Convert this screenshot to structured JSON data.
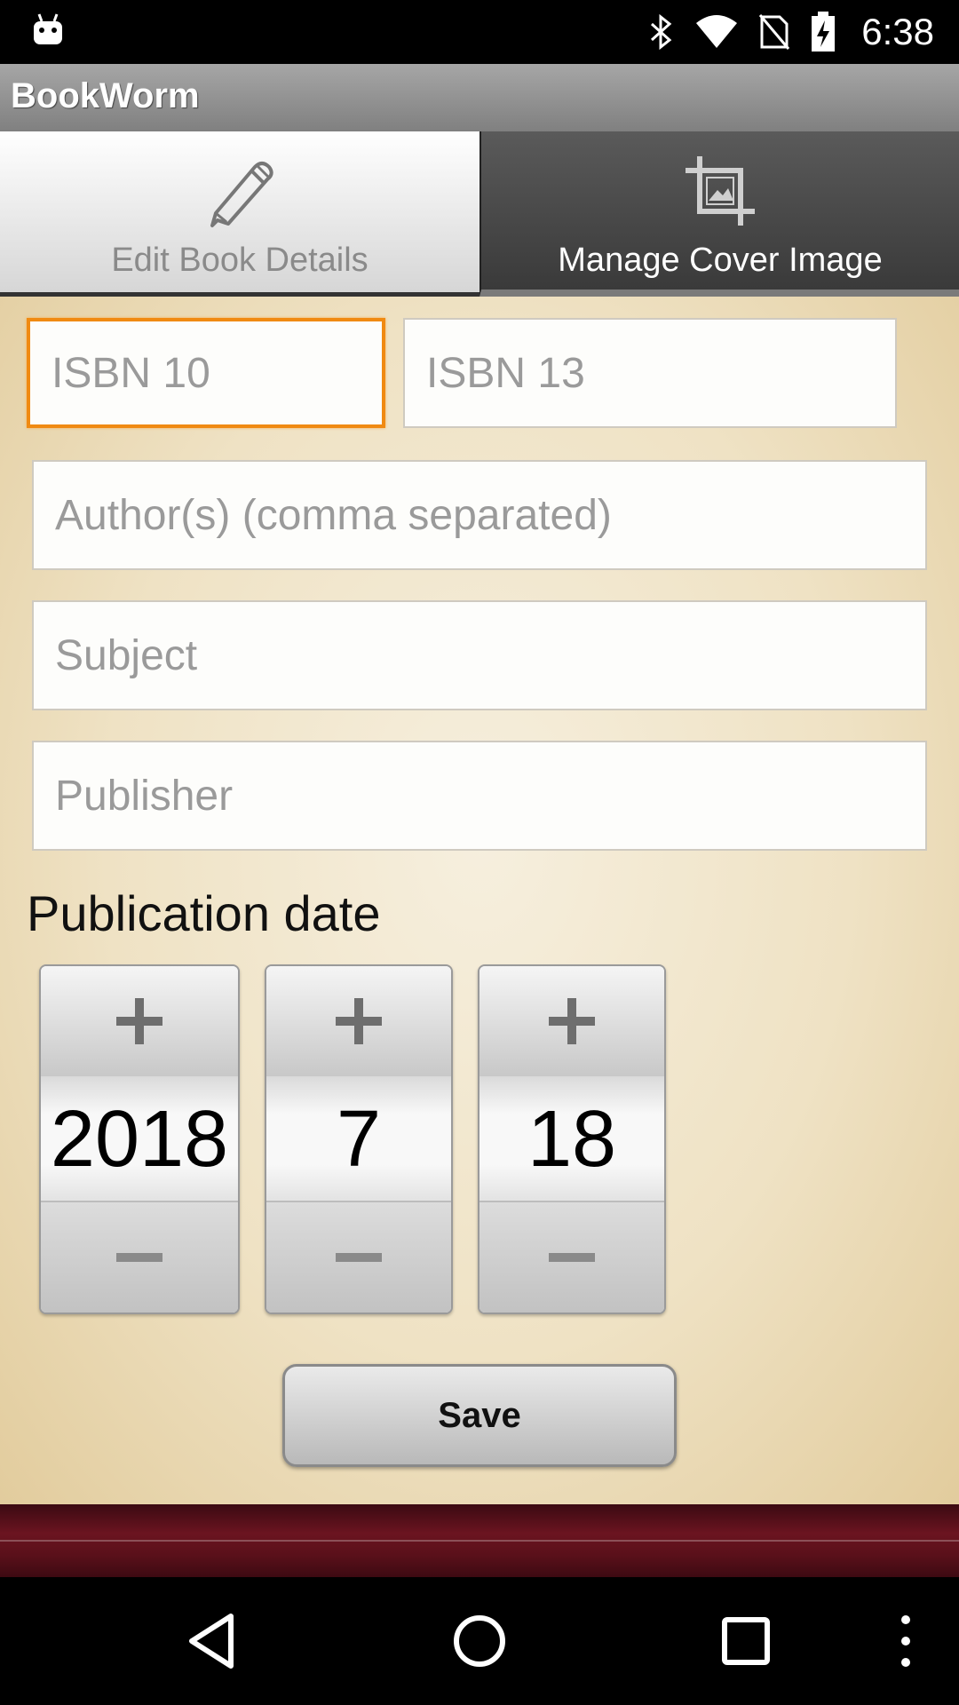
{
  "status_bar": {
    "time": "6:38",
    "icons": [
      "android-icon",
      "bluetooth-icon",
      "wifi-icon",
      "no-sim-icon",
      "battery-charging-icon"
    ]
  },
  "app": {
    "title": "BookWorm"
  },
  "tabs": [
    {
      "label": "Edit Book Details",
      "icon": "pencil-icon",
      "selected": true
    },
    {
      "label": "Manage Cover Image",
      "icon": "crop-icon",
      "selected": false
    }
  ],
  "form": {
    "isbn10": {
      "placeholder": "ISBN 10",
      "value": ""
    },
    "isbn13": {
      "placeholder": "ISBN 13",
      "value": ""
    },
    "authors": {
      "placeholder": "Author(s) (comma separated)",
      "value": ""
    },
    "subject": {
      "placeholder": "Subject",
      "value": ""
    },
    "publisher": {
      "placeholder": "Publisher",
      "value": ""
    }
  },
  "publication_date": {
    "label": "Publication date",
    "year": "2018",
    "month": "7",
    "day": "18"
  },
  "save": {
    "label": "Save"
  },
  "colors": {
    "focus": "#f08a12",
    "leather": "#6b1420"
  },
  "nav_bar": {
    "icons": [
      "back-icon",
      "home-icon",
      "recents-icon",
      "menu-icon"
    ]
  }
}
